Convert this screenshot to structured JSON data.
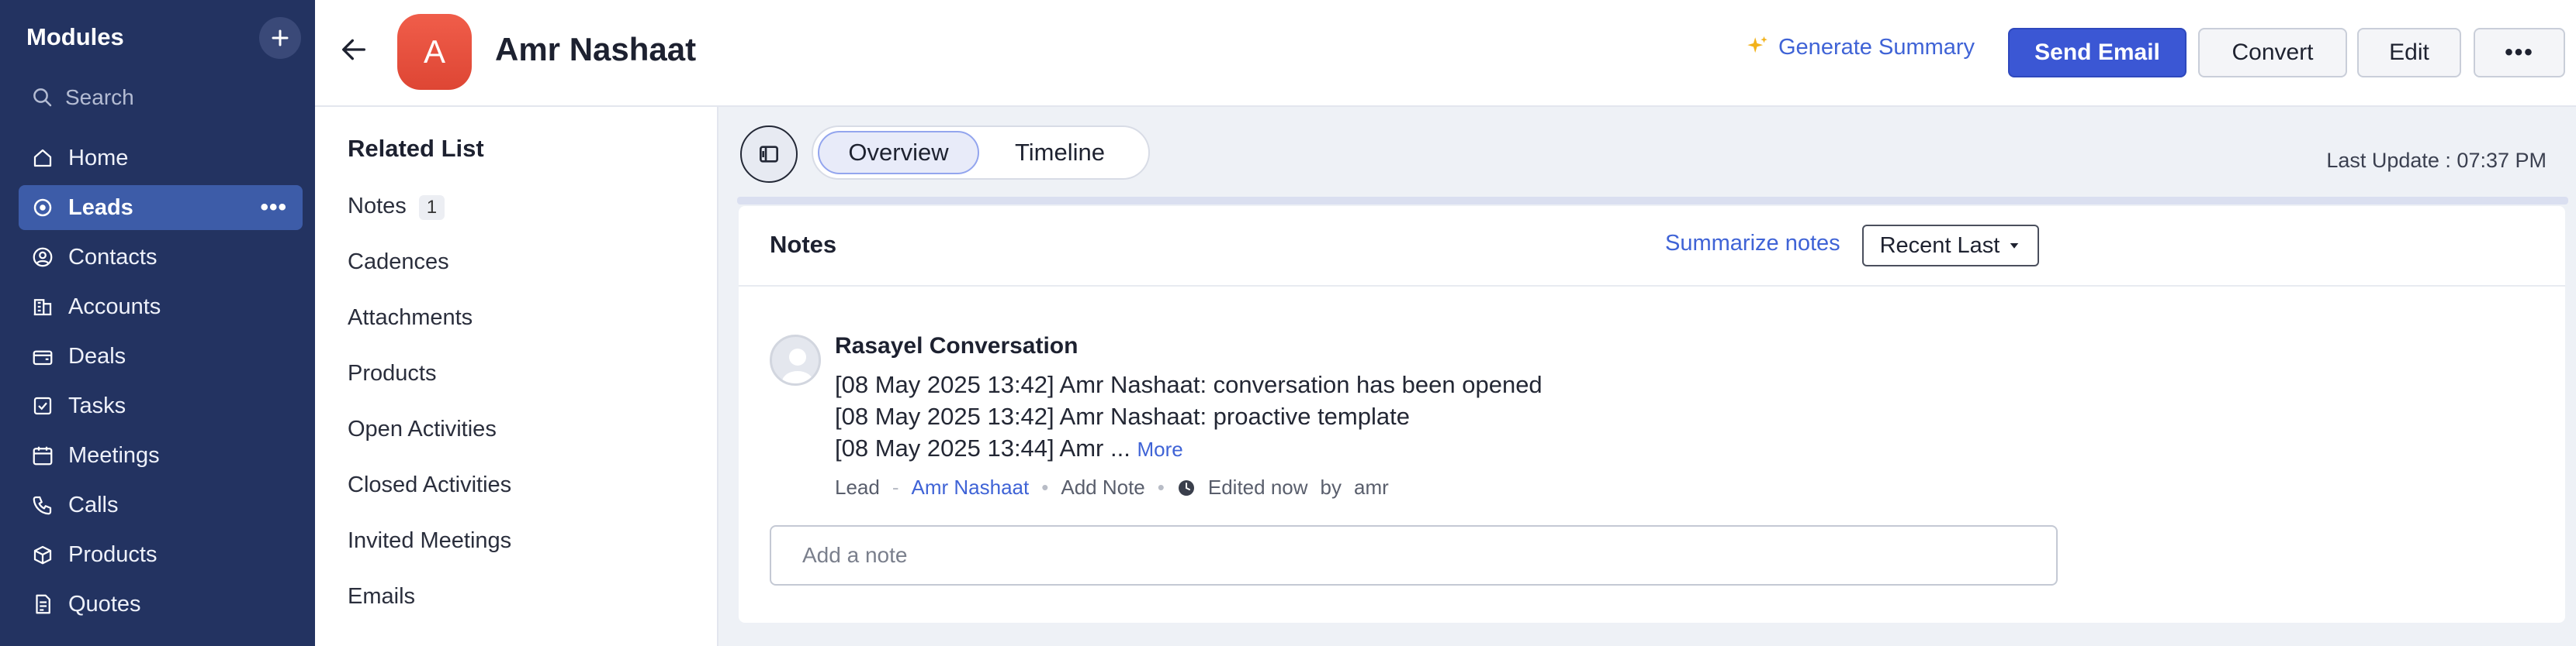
{
  "sidebar": {
    "title": "Modules",
    "search_placeholder": "Search",
    "items": [
      {
        "label": "Home",
        "icon": "home-icon"
      },
      {
        "label": "Leads",
        "icon": "leads-icon",
        "active": true
      },
      {
        "label": "Contacts",
        "icon": "contacts-icon"
      },
      {
        "label": "Accounts",
        "icon": "accounts-icon"
      },
      {
        "label": "Deals",
        "icon": "deals-icon"
      },
      {
        "label": "Tasks",
        "icon": "tasks-icon"
      },
      {
        "label": "Meetings",
        "icon": "meetings-icon"
      },
      {
        "label": "Calls",
        "icon": "calls-icon"
      },
      {
        "label": "Products",
        "icon": "products-icon"
      },
      {
        "label": "Quotes",
        "icon": "quotes-icon"
      }
    ],
    "more_label": "•••"
  },
  "header": {
    "avatar_letter": "A",
    "record_name": "Amr Nashaat",
    "generate_summary": "Generate Summary",
    "send_email": "Send Email",
    "convert": "Convert",
    "edit": "Edit",
    "more": "•••"
  },
  "related_list": {
    "title": "Related List",
    "items": [
      {
        "label": "Notes",
        "count": "1"
      },
      {
        "label": "Cadences"
      },
      {
        "label": "Attachments"
      },
      {
        "label": "Products"
      },
      {
        "label": "Open Activities"
      },
      {
        "label": "Closed Activities"
      },
      {
        "label": "Invited Meetings"
      },
      {
        "label": "Emails"
      }
    ]
  },
  "main": {
    "tabs": [
      "Overview",
      "Timeline"
    ],
    "last_update": "Last Update : 07:37 PM",
    "notes": {
      "title": "Notes",
      "summarize": "Summarize notes",
      "sort": "Recent Last",
      "note": {
        "title": "Rasayel Conversation",
        "lines": [
          "[08 May 2025 13:42]  Amr Nashaat: conversation has been opened",
          "[08 May 2025 13:42]  Amr Nashaat: proactive template",
          "[08 May 2025 13:44] Amr ..."
        ],
        "more": "More",
        "meta": {
          "module": "Lead",
          "dash": "-",
          "record": "Amr Nashaat",
          "add_note": "Add Note",
          "edited": "Edited now",
          "by": "by",
          "user": "amr"
        }
      },
      "add_placeholder": "Add a note"
    }
  },
  "colors": {
    "sidebar_bg": "#233361",
    "active_item": "#3d5ca8",
    "primary": "#3b57d4",
    "link": "#3f63d6",
    "avatar": "#e8503d"
  }
}
